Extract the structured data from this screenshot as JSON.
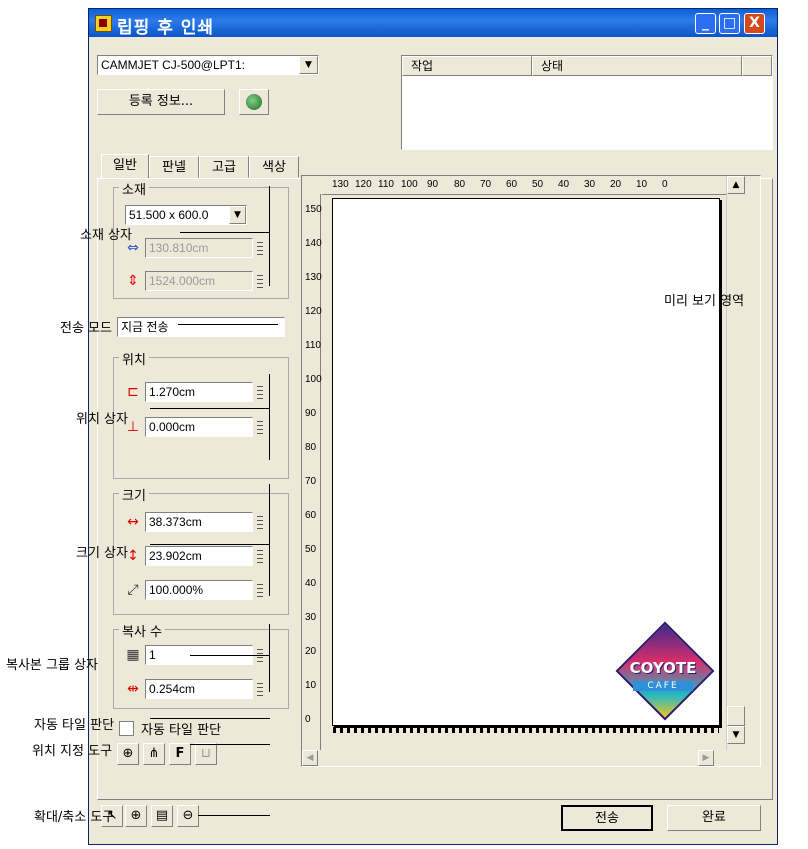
{
  "window": {
    "title": "립핑 후 인쇄",
    "min_glyph": "_",
    "max_glyph": "□",
    "close_glyph": "X"
  },
  "printer": {
    "selected": "CAMMJET CJ-500@LPT1:"
  },
  "register_button": "등록 정보...",
  "job_list": {
    "col_job": "작업",
    "col_status": "상태"
  },
  "tabs": [
    "일반",
    "판넬",
    "고급",
    "색상"
  ],
  "media": {
    "label": "소재",
    "size": "51.500 x 600.0",
    "width": "130.810cm",
    "length": "1524.000cm"
  },
  "send_mode": {
    "selected": "지금 전송"
  },
  "position": {
    "label": "위치",
    "x": "1.270cm",
    "y": "0.000cm"
  },
  "size": {
    "label": "크기",
    "width": "38.373cm",
    "height": "23.902cm",
    "scale": "100.000%"
  },
  "copies": {
    "label": "복사 수",
    "count": "1",
    "spacing": "0.254cm"
  },
  "auto_tile": {
    "label": "자동 타일 판단"
  },
  "ruler": {
    "h_ticks": [
      "130",
      "120",
      "110",
      "100",
      "90",
      "80",
      "70",
      "60",
      "50",
      "40",
      "30",
      "20",
      "10",
      "0"
    ],
    "v_ticks": [
      "150",
      "140",
      "130",
      "120",
      "110",
      "100",
      "90",
      "80",
      "70",
      "60",
      "50",
      "40",
      "30",
      "20",
      "10",
      "0"
    ]
  },
  "preview": {
    "logo_text": "COYOTE",
    "logo_sub": "CAFE"
  },
  "buttons": {
    "send": "전송",
    "done": "완료"
  },
  "callouts": {
    "media_box": "소재 상자",
    "preview_area": "미리 보기 영역",
    "send_mode": "전송 모드",
    "position_box": "위치 상자",
    "size_box": "크기 상자",
    "copy_group": "복사본 그룹 상자",
    "auto_tile": "자동 타일 판단",
    "position_tools": "위치 지정 도구",
    "zoom_tools": "확대/축소 도구"
  }
}
